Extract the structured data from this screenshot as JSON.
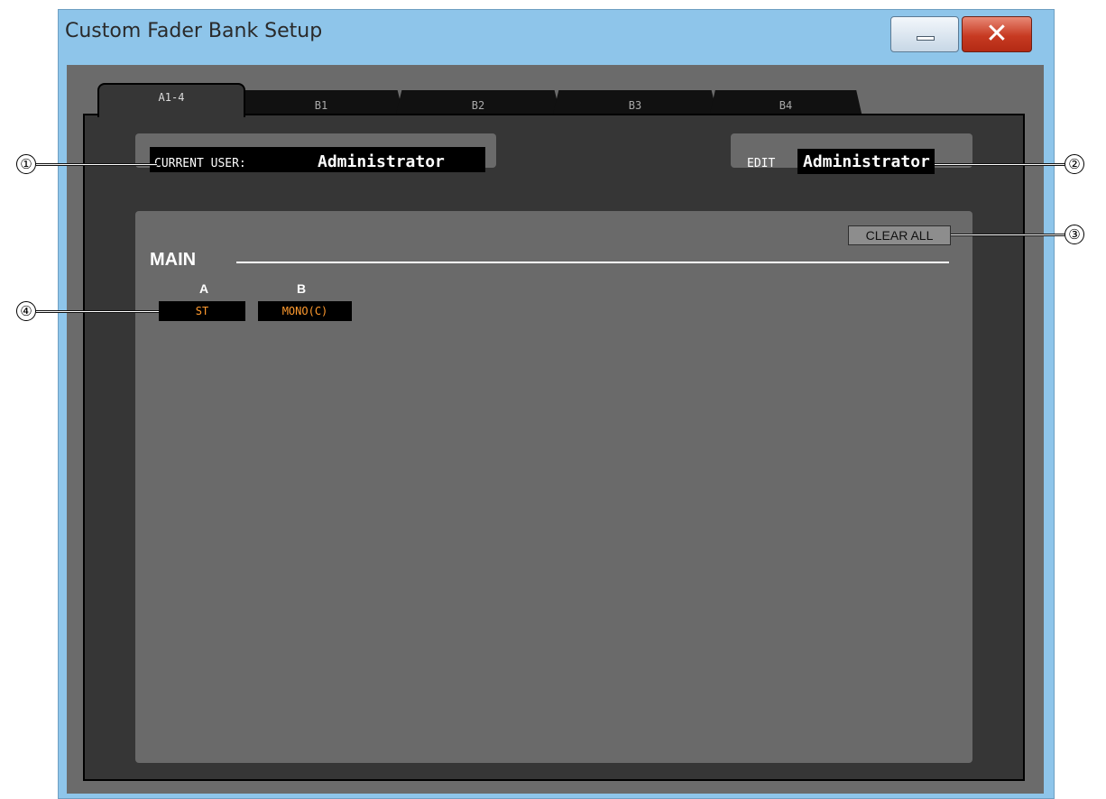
{
  "window": {
    "title": "Custom Fader Bank Setup",
    "minimize_icon": "minimize-icon",
    "close_icon": "close-icon",
    "close_glyph": "✕"
  },
  "tabs": [
    {
      "label": "A1-4",
      "active": true
    },
    {
      "label": "B1",
      "active": false
    },
    {
      "label": "B2",
      "active": false
    },
    {
      "label": "B3",
      "active": false
    },
    {
      "label": "B4",
      "active": false
    }
  ],
  "current_user": {
    "label": "CURRENT USER:",
    "value": "Administrator"
  },
  "edit": {
    "label": "EDIT",
    "value": "Administrator"
  },
  "clear_all_label": "CLEAR ALL",
  "section": {
    "title": "MAIN",
    "columns": [
      {
        "header": "A",
        "channel": "ST"
      },
      {
        "header": "B",
        "channel": "MONO(C)"
      }
    ]
  },
  "callouts": [
    "①",
    "②",
    "③",
    "④"
  ],
  "colors": {
    "window_frame": "#8ec5ea",
    "client_bg": "#6b6b6b",
    "panel_bg": "#6a6a6a",
    "frame_bg": "#363636",
    "channel_text": "#ff9a2e"
  }
}
